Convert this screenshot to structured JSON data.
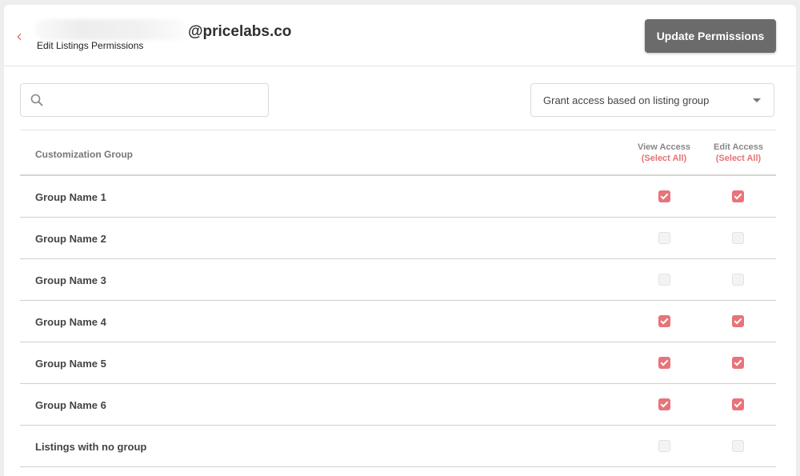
{
  "header": {
    "email_suffix": "@pricelabs.co",
    "subtitle": "Edit Listings Permissions",
    "update_button": "Update Permissions"
  },
  "search": {
    "value": "",
    "placeholder": ""
  },
  "grant_select": {
    "value": "Grant access based on listing group"
  },
  "table": {
    "columns": {
      "group": "Customization Group",
      "view": "View Access",
      "edit": "Edit Access",
      "select_all": "(Select All)"
    },
    "rows": [
      {
        "name": "Group Name 1",
        "view": true,
        "edit": true
      },
      {
        "name": "Group Name 2",
        "view": false,
        "edit": false
      },
      {
        "name": "Group Name 3",
        "view": false,
        "edit": false
      },
      {
        "name": "Group Name 4",
        "view": true,
        "edit": true
      },
      {
        "name": "Group Name 5",
        "view": true,
        "edit": true
      },
      {
        "name": "Group Name 6",
        "view": true,
        "edit": true
      },
      {
        "name": "Listings with no group",
        "view": false,
        "edit": false
      }
    ]
  },
  "colors": {
    "accent": "#e57373",
    "checkbox_on": "#e8737a",
    "button_bg": "#6b6b6b"
  },
  "icons": {
    "back": "chevron-left-icon",
    "search": "search-icon",
    "dropdown": "caret-down-icon"
  }
}
